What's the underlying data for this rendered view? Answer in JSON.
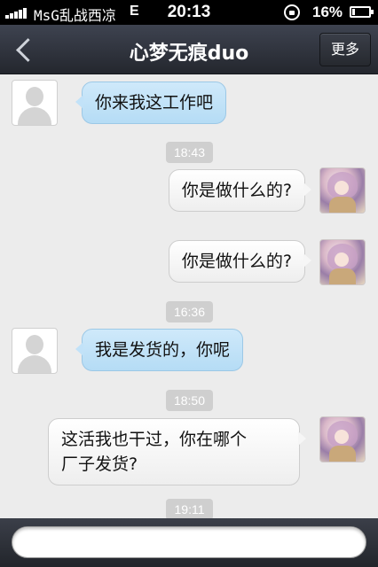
{
  "status_bar": {
    "carrier": "MsG乱战西凉",
    "network": "E",
    "time": "20:13",
    "battery": "16%"
  },
  "nav": {
    "title": "心梦无痕duo",
    "more_label": "更多"
  },
  "messages": [
    {
      "type": "incoming",
      "text": "你来我这工作吧"
    },
    {
      "type": "timestamp",
      "text": "18:43"
    },
    {
      "type": "outgoing",
      "text": "你是做什么的?"
    },
    {
      "type": "outgoing",
      "text": "你是做什么的?"
    },
    {
      "type": "timestamp",
      "text": "16:36"
    },
    {
      "type": "incoming",
      "text": "我是发货的，你呢"
    },
    {
      "type": "timestamp",
      "text": "18:50"
    },
    {
      "type": "outgoing",
      "text_line1": "这活我也干过，你在哪个",
      "text_line2": "厂子发货?"
    },
    {
      "type": "timestamp",
      "text": "19:11"
    }
  ],
  "input": {
    "value": "",
    "placeholder": ""
  },
  "colors": {
    "incoming_bubble": "#c2e2f8",
    "outgoing_bubble": "#f6f6f6",
    "nav_bar": "#2f333c",
    "background": "#ececec"
  }
}
